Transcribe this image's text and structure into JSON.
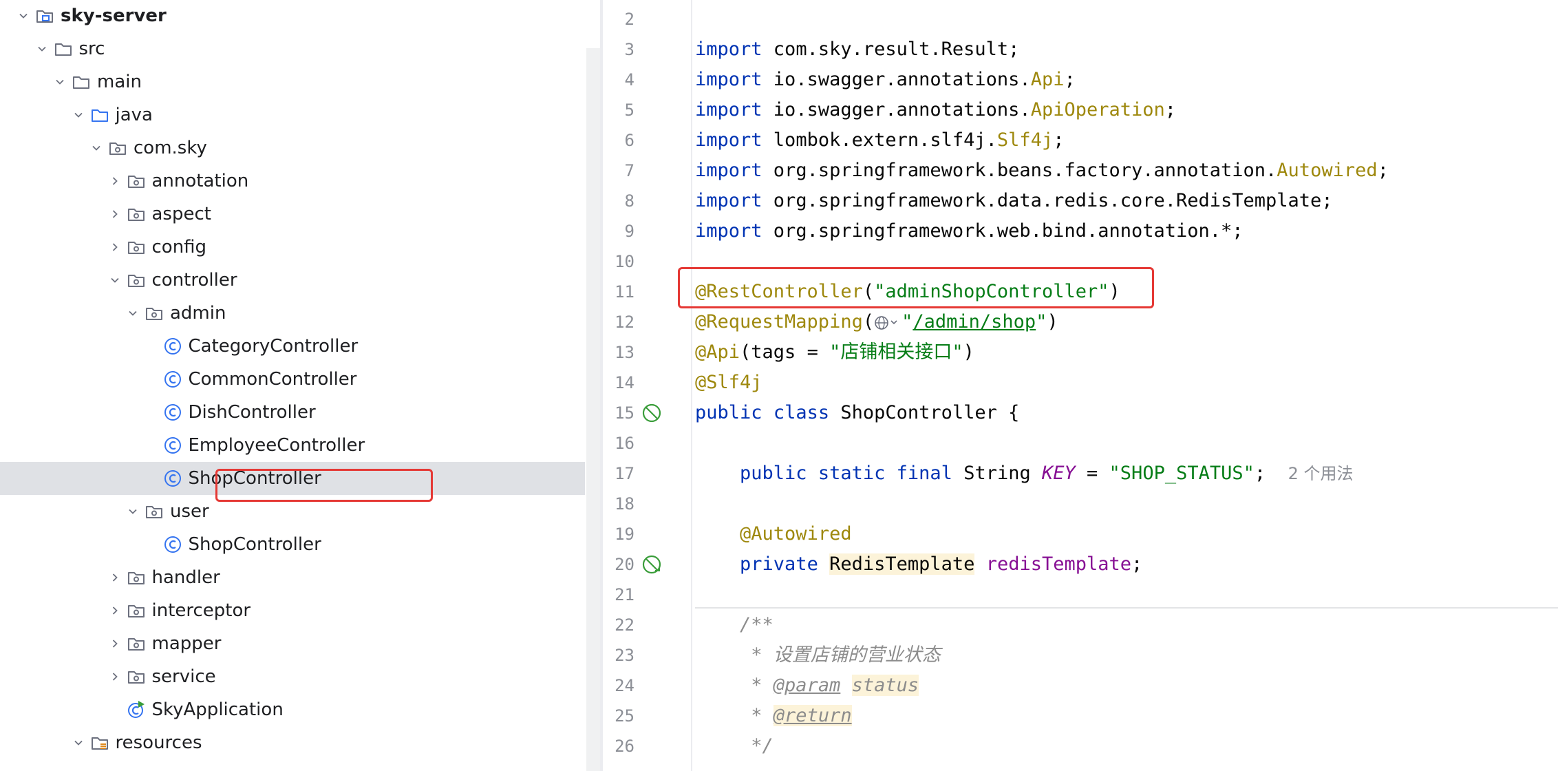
{
  "project_tree": {
    "items": [
      {
        "label": "sky-server",
        "depth": 0,
        "expanded": true,
        "icon": "module-folder-icon",
        "bold": true
      },
      {
        "label": "src",
        "depth": 1,
        "expanded": true,
        "icon": "folder-icon"
      },
      {
        "label": "main",
        "depth": 2,
        "expanded": true,
        "icon": "folder-icon"
      },
      {
        "label": "java",
        "depth": 3,
        "expanded": true,
        "icon": "source-folder-icon"
      },
      {
        "label": "com.sky",
        "depth": 4,
        "expanded": true,
        "icon": "package-icon"
      },
      {
        "label": "annotation",
        "depth": 5,
        "expanded": false,
        "icon": "package-icon"
      },
      {
        "label": "aspect",
        "depth": 5,
        "expanded": false,
        "icon": "package-icon"
      },
      {
        "label": "config",
        "depth": 5,
        "expanded": false,
        "icon": "package-icon"
      },
      {
        "label": "controller",
        "depth": 5,
        "expanded": true,
        "icon": "package-icon"
      },
      {
        "label": "admin",
        "depth": 6,
        "expanded": true,
        "icon": "package-icon"
      },
      {
        "label": "CategoryController",
        "depth": 7,
        "icon": "java-class-icon"
      },
      {
        "label": "CommonController",
        "depth": 7,
        "icon": "java-class-icon"
      },
      {
        "label": "DishController",
        "depth": 7,
        "icon": "java-class-icon"
      },
      {
        "label": "EmployeeController",
        "depth": 7,
        "icon": "java-class-icon"
      },
      {
        "label": "ShopController",
        "depth": 7,
        "icon": "java-class-icon",
        "selected": true
      },
      {
        "label": "user",
        "depth": 6,
        "expanded": true,
        "icon": "package-icon"
      },
      {
        "label": "ShopController",
        "depth": 7,
        "icon": "java-class-icon"
      },
      {
        "label": "handler",
        "depth": 5,
        "expanded": false,
        "icon": "package-icon"
      },
      {
        "label": "interceptor",
        "depth": 5,
        "expanded": false,
        "icon": "package-icon"
      },
      {
        "label": "mapper",
        "depth": 5,
        "expanded": false,
        "icon": "package-icon"
      },
      {
        "label": "service",
        "depth": 5,
        "expanded": false,
        "icon": "package-icon"
      },
      {
        "label": "SkyApplication",
        "depth": 5,
        "icon": "spring-boot-app-icon"
      },
      {
        "label": "resources",
        "depth": 3,
        "expanded": true,
        "icon": "resources-folder-icon"
      }
    ]
  },
  "editor": {
    "line_numbers": [
      "2",
      "3",
      "4",
      "5",
      "6",
      "7",
      "8",
      "9",
      "10",
      "11",
      "12",
      "13",
      "14",
      "15",
      "16",
      "17",
      "18",
      "19",
      "20",
      "21",
      "22",
      "23",
      "24",
      "25",
      "26"
    ],
    "gutter_icons": [
      {
        "line": "15",
        "icon": "spring-bean-icon"
      },
      {
        "line": "20",
        "icon": "spring-autowired-icon"
      }
    ],
    "lines": [
      [],
      [
        {
          "t": "import",
          "c": "kw"
        },
        {
          "t": " com.sky.result.Result;"
        }
      ],
      [
        {
          "t": "import",
          "c": "kw"
        },
        {
          "t": " io.swagger.annotations."
        },
        {
          "t": "Api",
          "c": "ann"
        },
        {
          "t": ";"
        }
      ],
      [
        {
          "t": "import",
          "c": "kw"
        },
        {
          "t": " io.swagger.annotations."
        },
        {
          "t": "ApiOperation",
          "c": "ann"
        },
        {
          "t": ";"
        }
      ],
      [
        {
          "t": "import",
          "c": "kw"
        },
        {
          "t": " lombok.extern.slf4j."
        },
        {
          "t": "Slf4j",
          "c": "ann"
        },
        {
          "t": ";"
        }
      ],
      [
        {
          "t": "import",
          "c": "kw"
        },
        {
          "t": " org.springframework.beans.factory.annotation."
        },
        {
          "t": "Autowired",
          "c": "ann"
        },
        {
          "t": ";"
        }
      ],
      [
        {
          "t": "import",
          "c": "kw"
        },
        {
          "t": " org.springframework.data.redis.core.RedisTemplate;"
        }
      ],
      [
        {
          "t": "import",
          "c": "kw"
        },
        {
          "t": " org.springframework.web.bind.annotation.*;"
        }
      ],
      [],
      [
        {
          "t": "@RestController",
          "c": "ann"
        },
        {
          "t": "("
        },
        {
          "t": "\"adminShopController\"",
          "c": "str"
        },
        {
          "t": ")"
        }
      ],
      [
        {
          "t": "@RequestMapping",
          "c": "ann"
        },
        {
          "t": "("
        },
        {
          "globe": true
        },
        {
          "t": "\"",
          "c": "str"
        },
        {
          "t": "/admin/shop",
          "c": "link"
        },
        {
          "t": "\"",
          "c": "str"
        },
        {
          "t": ")"
        }
      ],
      [
        {
          "t": "@Api",
          "c": "ann"
        },
        {
          "t": "(tags = "
        },
        {
          "t": "\"店铺相关接口\"",
          "c": "str"
        },
        {
          "t": ")"
        }
      ],
      [
        {
          "t": "@Slf4j",
          "c": "ann"
        }
      ],
      [
        {
          "t": "public",
          "c": "kw"
        },
        {
          "t": " "
        },
        {
          "t": "class",
          "c": "kw"
        },
        {
          "t": " ShopController {"
        }
      ],
      [],
      [
        {
          "t": "    "
        },
        {
          "t": "public",
          "c": "kw"
        },
        {
          "t": " "
        },
        {
          "t": "static",
          "c": "kw"
        },
        {
          "t": " "
        },
        {
          "t": "final",
          "c": "kw"
        },
        {
          "t": " String "
        },
        {
          "t": "KEY",
          "c": "kconst"
        },
        {
          "t": " = "
        },
        {
          "t": "\"SHOP_STATUS\"",
          "c": "str"
        },
        {
          "t": ";  "
        },
        {
          "t": "2 个用法",
          "c": "hint"
        }
      ],
      [],
      [
        {
          "t": "    "
        },
        {
          "t": "@Autowired",
          "c": "ann"
        }
      ],
      [
        {
          "t": "    "
        },
        {
          "t": "private",
          "c": "kw"
        },
        {
          "t": " "
        },
        {
          "t": "RedisTemplate",
          "c": "ybg"
        },
        {
          "t": " "
        },
        {
          "t": "redisTemplate",
          "c": "fld"
        },
        {
          "t": ";"
        }
      ],
      [],
      [
        {
          "t": "    /**",
          "c": "cmt"
        }
      ],
      [
        {
          "t": "     * 设置店铺的营业状态",
          "c": "cmt"
        }
      ],
      [
        {
          "t": "     * ",
          "c": "cmt"
        },
        {
          "t": "@param",
          "c": "tag"
        },
        {
          "t": " "
        },
        {
          "t": "status",
          "c": "cmt ybg"
        }
      ],
      [
        {
          "t": "     * ",
          "c": "cmt"
        },
        {
          "t": "@return",
          "c": "tag ybg"
        }
      ],
      [
        {
          "t": "     */",
          "c": "cmt"
        }
      ]
    ]
  },
  "colors": {
    "highlight_border": "#e53935",
    "selection_row": "#dfe1e5",
    "folder_icon": "#6c707e",
    "class_icon": "#3574f0"
  }
}
